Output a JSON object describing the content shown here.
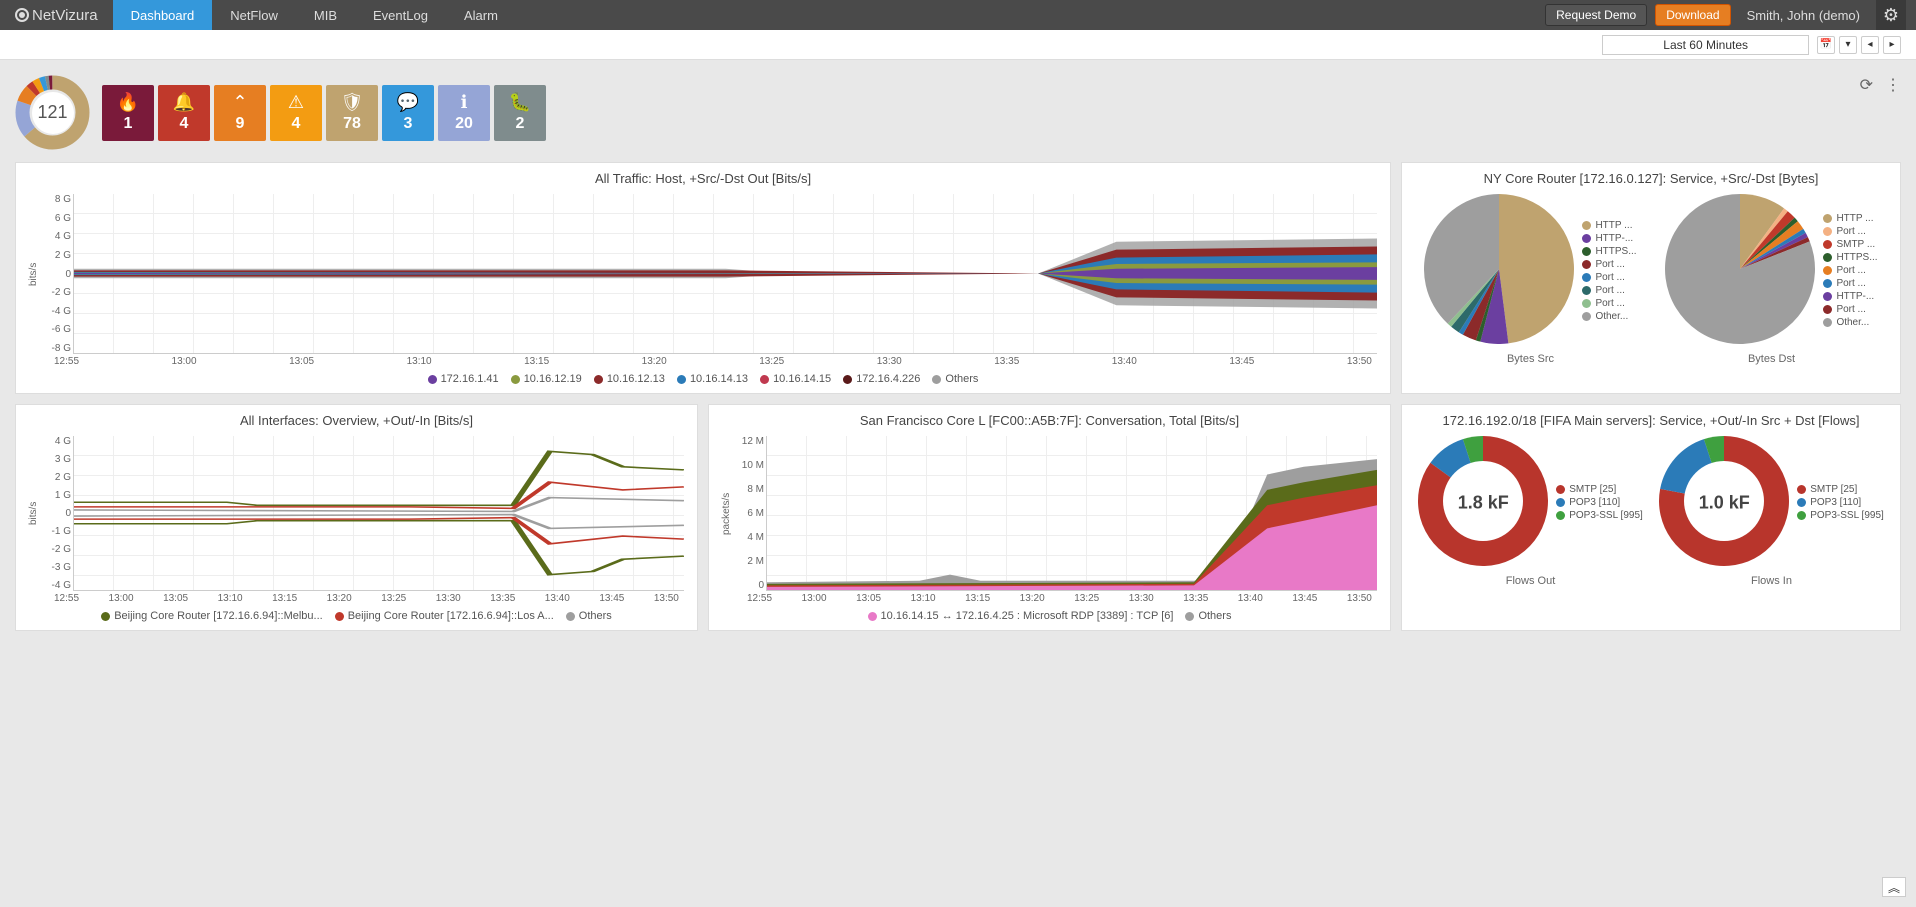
{
  "brand": "NetVizura",
  "nav": [
    "Dashboard",
    "NetFlow",
    "MIB",
    "EventLog",
    "Alarm"
  ],
  "active_nav": 0,
  "topbar": {
    "request_demo": "Request Demo",
    "download": "Download",
    "user": "Smith, John (demo)"
  },
  "time_selector": "Last 60 Minutes",
  "main_total": "121",
  "tiles": [
    {
      "icon": "🔥",
      "count": "1",
      "color": "#7a1a3a"
    },
    {
      "icon": "🔔",
      "count": "4",
      "color": "#c0392b"
    },
    {
      "icon": "⌃",
      "count": "9",
      "color": "#e67e22"
    },
    {
      "icon": "⚠",
      "count": "4",
      "color": "#f39c12"
    },
    {
      "icon": "🛡",
      "count": "78",
      "color": "#bfa36f"
    },
    {
      "icon": "💬",
      "count": "3",
      "color": "#3498db"
    },
    {
      "icon": "ℹ",
      "count": "20",
      "color": "#95a5d6"
    },
    {
      "icon": "🐛",
      "count": "2",
      "color": "#7f8c8d"
    }
  ],
  "chart_data": [
    {
      "id": "all_traffic",
      "type": "area",
      "title": "All Traffic: Host, +Src/-Dst Out [Bits/s]",
      "ylabel": "bits/s",
      "y_ticks": [
        "8 G",
        "6 G",
        "4 G",
        "2 G",
        "0",
        "-2 G",
        "-4 G",
        "-6 G",
        "-8 G"
      ],
      "x_ticks": [
        "12:55",
        "13:00",
        "13:05",
        "13:10",
        "13:15",
        "13:20",
        "13:25",
        "13:30",
        "13:35",
        "13:40",
        "13:45",
        "13:50"
      ],
      "series": [
        {
          "name": "172.16.1.41",
          "color": "#6b3fa0"
        },
        {
          "name": "10.16.12.19",
          "color": "#8a9a3f"
        },
        {
          "name": "10.16.12.13",
          "color": "#8c2a2a"
        },
        {
          "name": "10.16.14.13",
          "color": "#2b7bb8"
        },
        {
          "name": "10.16.14.15",
          "color": "#c0394f"
        },
        {
          "name": "172.16.4.226",
          "color": "#5a1a1a"
        },
        {
          "name": "Others",
          "color": "#9e9e9e"
        }
      ]
    },
    {
      "id": "ny_core",
      "type": "pie",
      "title": "NY Core Router [172.16.0.127]: Service, +Src/-Dst [Bytes]",
      "subcharts": [
        {
          "label": "Bytes Src",
          "slices": [
            {
              "name": "HTTP ...",
              "value": 48,
              "color": "#bfa36f"
            },
            {
              "name": "HTTP-...",
              "value": 6,
              "color": "#6b3fa0"
            },
            {
              "name": "HTTPS...",
              "value": 1,
              "color": "#2d5f2d"
            },
            {
              "name": "Port ...",
              "value": 3,
              "color": "#8c2a2a"
            },
            {
              "name": "Port ...",
              "value": 1,
              "color": "#2b7bb8"
            },
            {
              "name": "Port ...",
              "value": 2,
              "color": "#2d6a6a"
            },
            {
              "name": "Port ...",
              "value": 1,
              "color": "#8fbf8f"
            },
            {
              "name": "Other...",
              "value": 38,
              "color": "#9e9e9e"
            }
          ]
        },
        {
          "label": "Bytes Dst",
          "slices": [
            {
              "name": "HTTP ...",
              "value": 10,
              "color": "#bfa36f"
            },
            {
              "name": "Port ...",
              "value": 1,
              "color": "#f4b183"
            },
            {
              "name": "SMTP ...",
              "value": 2,
              "color": "#c0392b"
            },
            {
              "name": "HTTPS...",
              "value": 1,
              "color": "#2d5f2d"
            },
            {
              "name": "Port ...",
              "value": 2,
              "color": "#e67e22"
            },
            {
              "name": "Port ...",
              "value": 1,
              "color": "#2b7bb8"
            },
            {
              "name": "HTTP-...",
              "value": 1,
              "color": "#6b3fa0"
            },
            {
              "name": "Port ...",
              "value": 1,
              "color": "#8c2a2a"
            },
            {
              "name": "Other...",
              "value": 81,
              "color": "#9e9e9e"
            }
          ]
        }
      ]
    },
    {
      "id": "all_interfaces",
      "type": "line",
      "title": "All Interfaces: Overview, +Out/-In [Bits/s]",
      "ylabel": "bits/s",
      "y_ticks": [
        "4 G",
        "3 G",
        "2 G",
        "1 G",
        "0",
        "-1 G",
        "-2 G",
        "-3 G",
        "-4 G"
      ],
      "x_ticks": [
        "12:55",
        "13:00",
        "13:05",
        "13:10",
        "13:15",
        "13:20",
        "13:25",
        "13:30",
        "13:35",
        "13:40",
        "13:45",
        "13:50"
      ],
      "series": [
        {
          "name": "Beijing Core Router [172.16.6.94]::Melbu...",
          "color": "#5a6b1a"
        },
        {
          "name": "Beijing Core Router [172.16.6.94]::Los A...",
          "color": "#c0392b"
        },
        {
          "name": "Others",
          "color": "#9e9e9e"
        }
      ]
    },
    {
      "id": "sf_core",
      "type": "area",
      "title": "San Francisco Core L [FC00::A5B:7F]: Conversation, Total [Bits/s]",
      "ylabel": "packets/s",
      "y_ticks": [
        "12 M",
        "10 M",
        "8 M",
        "6 M",
        "4 M",
        "2 M",
        "0"
      ],
      "x_ticks": [
        "12:55",
        "13:00",
        "13:05",
        "13:10",
        "13:15",
        "13:20",
        "13:25",
        "13:30",
        "13:35",
        "13:40",
        "13:45",
        "13:50"
      ],
      "series": [
        {
          "name": "10.16.14.15 ↔ 172.16.4.25 : Microsoft RDP [3389] : TCP [6]",
          "color": "#e879c7"
        },
        {
          "name": "Others",
          "color": "#9e9e9e"
        }
      ]
    },
    {
      "id": "fifa",
      "type": "donut",
      "title": "172.16.192.0/18 [FIFA Main servers]: Service, +Out/-In Src + Dst [Flows]",
      "subcharts": [
        {
          "label": "Flows Out",
          "center": "1.8 kF",
          "slices": [
            {
              "name": "SMTP [25]",
              "value": 85,
              "color": "#b8352c"
            },
            {
              "name": "POP3 [110]",
              "value": 10,
              "color": "#2b7bb8"
            },
            {
              "name": "POP3-SSL [995]",
              "value": 5,
              "color": "#3fa03f"
            }
          ]
        },
        {
          "label": "Flows In",
          "center": "1.0 kF",
          "slices": [
            {
              "name": "SMTP [25]",
              "value": 78,
              "color": "#b8352c"
            },
            {
              "name": "POP3 [110]",
              "value": 17,
              "color": "#2b7bb8"
            },
            {
              "name": "POP3-SSL [995]",
              "value": 5,
              "color": "#3fa03f"
            }
          ]
        }
      ]
    }
  ]
}
